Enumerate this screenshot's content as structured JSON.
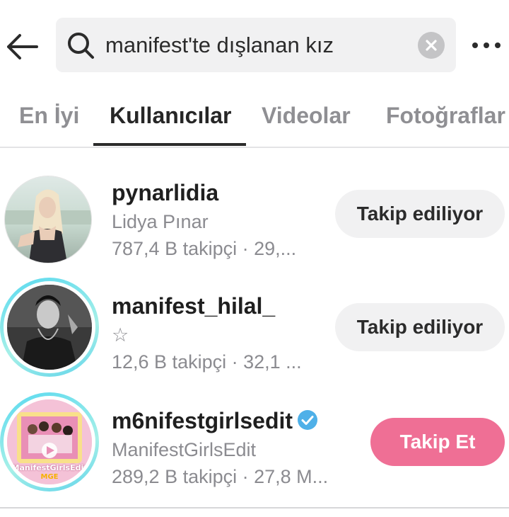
{
  "search": {
    "query": "manifest'te dışlanan kız"
  },
  "tabs": [
    {
      "label": "En İyi"
    },
    {
      "label": "Kullanıcılar"
    },
    {
      "label": "Videolar"
    },
    {
      "label": "Fotoğraflar"
    }
  ],
  "users": [
    {
      "username": "pynarlidia",
      "display_name": "Lidya Pınar",
      "stats": "787,4 B takipçi · 29,...",
      "button": "Takip ediliyor",
      "verified": false
    },
    {
      "username": "manifest_hilal_",
      "display_name": "☆",
      "stats": "12,6 B takipçi · 32,1 ...",
      "button": "Takip ediliyor",
      "verified": false
    },
    {
      "username": "m6nifestgirlsedit",
      "display_name": "ManifestGirlsEdit",
      "stats": "289,2 B takipçi · 27,8 M...",
      "button": "Takip Et",
      "verified": true,
      "avatar_text": "ManifestGirlsEdit",
      "avatar_sub": "MGE"
    }
  ],
  "colors": {
    "follow_button": "#ef6f95",
    "verified_badge": "#4fb0e8",
    "story_ring": "#59d9ef"
  },
  "icons": [
    "back-arrow-icon",
    "search-icon",
    "clear-icon",
    "more-icon",
    "verified-icon",
    "play-icon"
  ]
}
